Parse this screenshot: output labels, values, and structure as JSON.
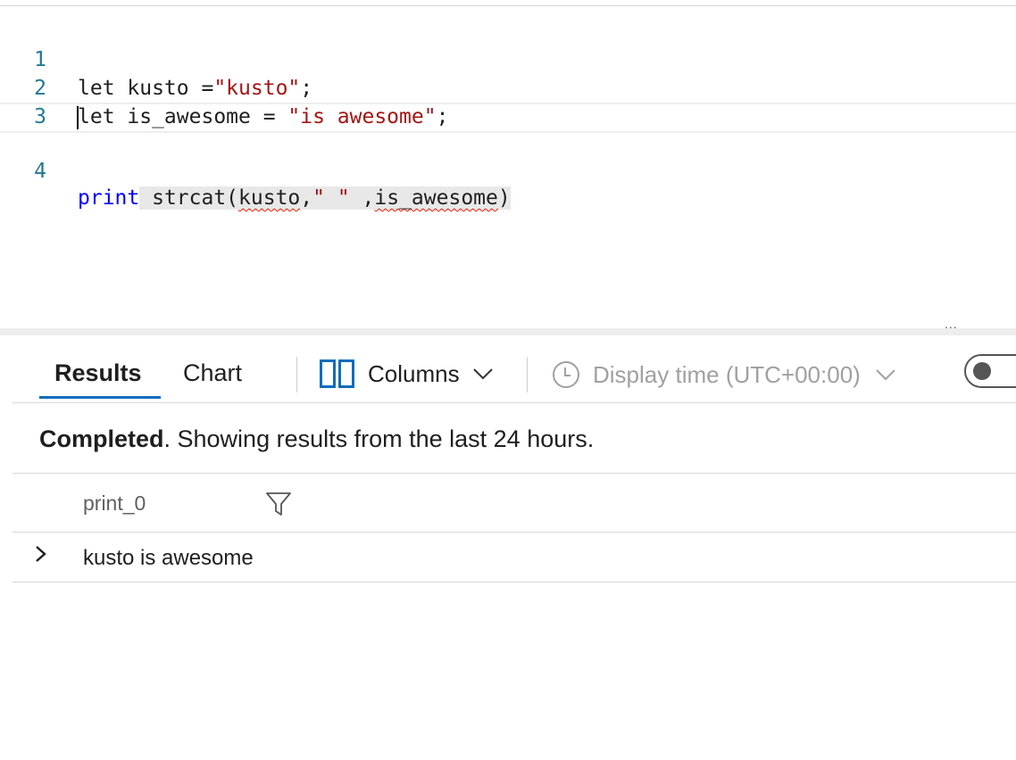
{
  "editor": {
    "lines": [
      {
        "number": "1",
        "tokens": [
          {
            "text": "let kusto =",
            "kind": "plain"
          },
          {
            "text": "\"kusto\"",
            "kind": "string"
          },
          {
            "text": ";",
            "kind": "plain"
          }
        ]
      },
      {
        "number": "2",
        "tokens": [
          {
            "text": "let is_awesome = ",
            "kind": "plain"
          },
          {
            "text": "\"is awesome\"",
            "kind": "string"
          },
          {
            "text": ";",
            "kind": "plain"
          }
        ]
      },
      {
        "number": "3",
        "tokens": []
      },
      {
        "number": "4",
        "tokens": [
          {
            "text": "print",
            "kind": "keyword"
          },
          {
            "text": " strcat(",
            "kind": "plain"
          },
          {
            "text": "kusto",
            "kind": "error"
          },
          {
            "text": ",",
            "kind": "plain"
          },
          {
            "text": "\" \"",
            "kind": "string"
          },
          {
            "text": " ,",
            "kind": "plain"
          },
          {
            "text": "is_awesome",
            "kind": "error"
          },
          {
            "text": ")",
            "kind": "plain"
          }
        ]
      }
    ],
    "colors": {
      "keyword": "#0000ff",
      "string": "#a31515",
      "line_number": "#237893",
      "error_squiggle": "#e51400"
    }
  },
  "results_panel": {
    "more_label": "...",
    "tabs": [
      {
        "label": "Results",
        "active": true
      },
      {
        "label": "Chart",
        "active": false
      }
    ],
    "columns_button": {
      "label": "Columns",
      "icon": "columns-icon"
    },
    "display_time": {
      "label": "Display time (UTC+00:00)",
      "icon": "clock-icon"
    },
    "toggle": {
      "on": false
    },
    "accent_color": "#0f6cbd"
  },
  "status": {
    "state": "Completed",
    "message": ". Showing results from the last 24 hours."
  },
  "grid": {
    "columns": [
      {
        "name": "print_0"
      }
    ],
    "rows": [
      {
        "cells": [
          "kusto is awesome"
        ]
      }
    ]
  }
}
